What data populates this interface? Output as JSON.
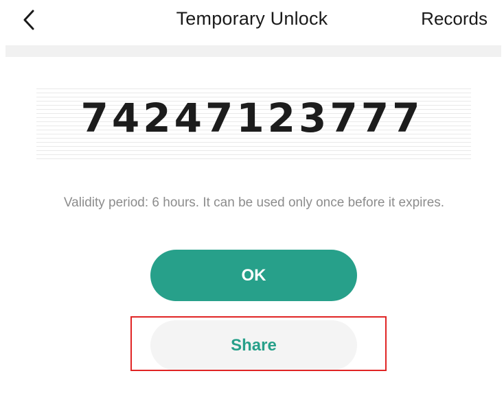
{
  "header": {
    "title": "Temporary Unlock",
    "records_label": "Records",
    "back_icon": "chevron-left-icon"
  },
  "code": {
    "value": "74247123777"
  },
  "validity": {
    "text": "Validity period: 6 hours. It can be used only once before it expires."
  },
  "actions": {
    "ok_label": "OK",
    "share_label": "Share"
  },
  "colors": {
    "accent": "#27a08a",
    "highlight_border": "#e02424",
    "secondary_button_bg": "#f4f4f4",
    "muted_text": "#8c8c8c"
  }
}
